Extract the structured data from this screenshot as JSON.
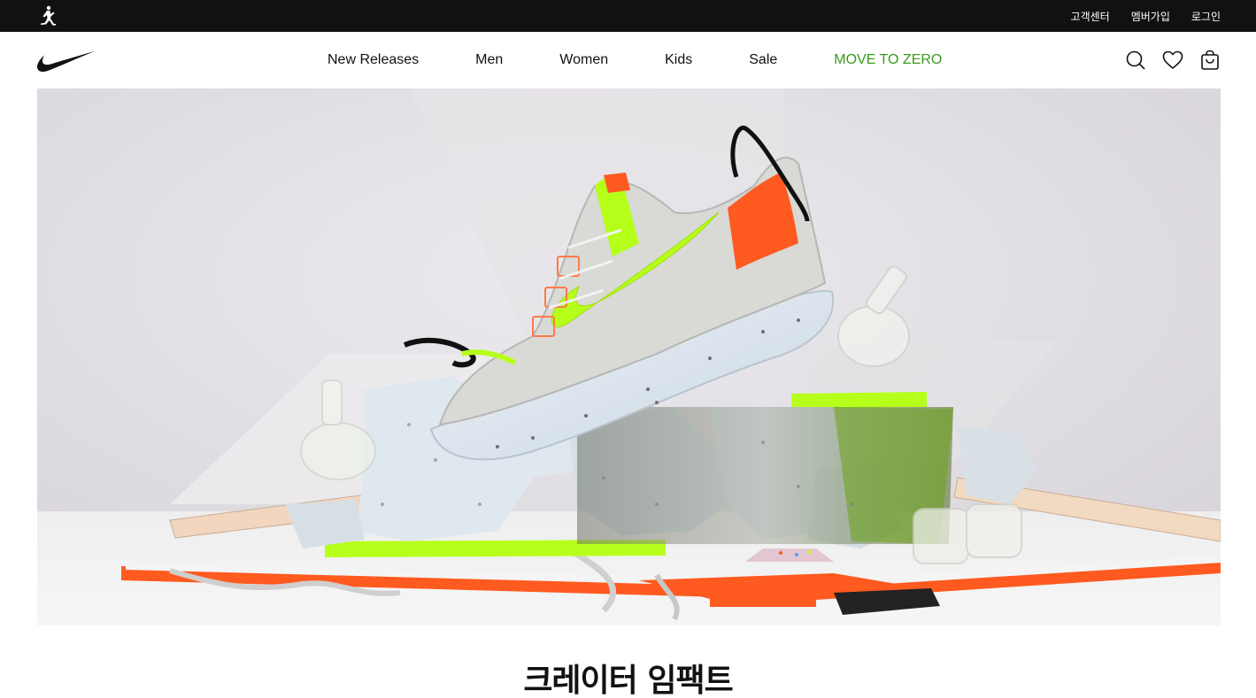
{
  "utility_bar": {
    "links": [
      "고객센터",
      "멤버가입",
      "로그인"
    ]
  },
  "nav": {
    "items": [
      "New Releases",
      "Men",
      "Women",
      "Kids",
      "Sale",
      "MOVE TO ZERO"
    ]
  },
  "colors": {
    "utility_bar_bg": "#111111",
    "move_to_zero": "#3a9a1c",
    "volt": "#b6ff1a",
    "orange": "#ff5a1f"
  },
  "hero": {
    "image": "sneaker-crater-impact-hero"
  },
  "section": {
    "title": "크레이터 임팩트"
  }
}
